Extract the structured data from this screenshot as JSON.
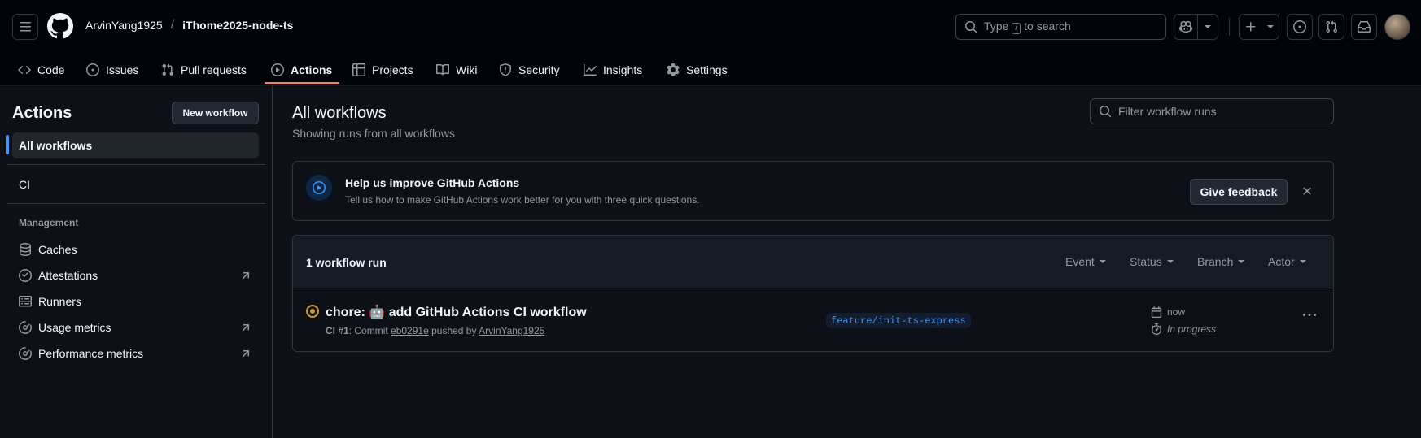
{
  "header": {
    "owner": "ArvinYang1925",
    "separator": "/",
    "repo": "iThome2025-node-ts",
    "search_prefix": "Type",
    "search_key": "/",
    "search_suffix": "to search"
  },
  "tabs": [
    {
      "label": "Code",
      "icon": "code-icon"
    },
    {
      "label": "Issues",
      "icon": "issue-opened-icon"
    },
    {
      "label": "Pull requests",
      "icon": "git-pull-request-icon"
    },
    {
      "label": "Actions",
      "icon": "play-icon",
      "active": true
    },
    {
      "label": "Projects",
      "icon": "table-icon"
    },
    {
      "label": "Wiki",
      "icon": "book-icon"
    },
    {
      "label": "Security",
      "icon": "shield-icon"
    },
    {
      "label": "Insights",
      "icon": "graph-icon"
    },
    {
      "label": "Settings",
      "icon": "gear-icon"
    }
  ],
  "sidebar": {
    "title": "Actions",
    "new_workflow": "New workflow",
    "all_workflows": "All workflows",
    "workflows": [
      "CI"
    ],
    "management_heading": "Management",
    "management": [
      {
        "label": "Caches",
        "icon": "database-icon",
        "external": false
      },
      {
        "label": "Attestations",
        "icon": "verified-icon",
        "external": true
      },
      {
        "label": "Runners",
        "icon": "server-icon",
        "external": false
      },
      {
        "label": "Usage metrics",
        "icon": "meter-icon",
        "external": true
      },
      {
        "label": "Performance metrics",
        "icon": "meter-icon",
        "external": true
      }
    ]
  },
  "main": {
    "title": "All workflows",
    "subtitle": "Showing runs from all workflows",
    "filter_placeholder": "Filter workflow runs"
  },
  "banner": {
    "title": "Help us improve GitHub Actions",
    "text": "Tell us how to make GitHub Actions work better for you with three quick questions.",
    "button": "Give feedback"
  },
  "runs": {
    "count_label": "1 workflow run",
    "filters": [
      "Event",
      "Status",
      "Branch",
      "Actor"
    ],
    "items": [
      {
        "title": "chore: 🤖 add GitHub Actions CI workflow",
        "workflow": "CI #1",
        "meta_commit_prefix": ": Commit",
        "commit": "eb0291e",
        "pushed_by": "pushed by",
        "actor": "ArvinYang1925",
        "branch": "feature/init-ts-express",
        "time": "now",
        "duration": "In progress",
        "status_color": "#d29922"
      }
    ]
  },
  "colors": {
    "accent_underline": "#f78166",
    "link_blue": "#4493f8",
    "background": "#0d1117"
  }
}
